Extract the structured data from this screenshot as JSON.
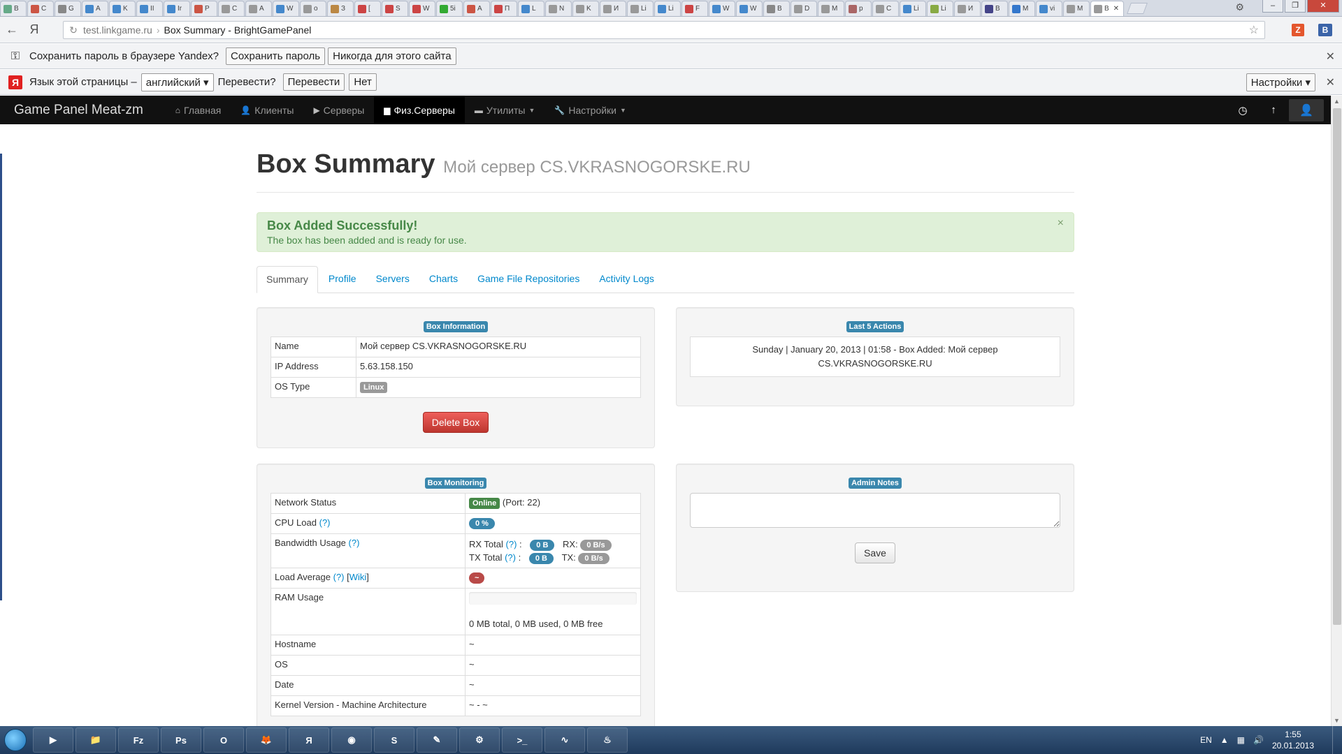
{
  "browser": {
    "tabs": [
      {
        "label": "В"
      },
      {
        "label": "С"
      },
      {
        "label": "G"
      },
      {
        "label": "A"
      },
      {
        "label": "K"
      },
      {
        "label": "II"
      },
      {
        "label": "Ir"
      },
      {
        "label": "P"
      },
      {
        "label": "C"
      },
      {
        "label": "A"
      },
      {
        "label": "W"
      },
      {
        "label": "o"
      },
      {
        "label": "З"
      },
      {
        "label": "["
      },
      {
        "label": "S"
      },
      {
        "label": "W"
      },
      {
        "label": "5i"
      },
      {
        "label": "A"
      },
      {
        "label": "П"
      },
      {
        "label": "L"
      },
      {
        "label": "N"
      },
      {
        "label": "K"
      },
      {
        "label": "И"
      },
      {
        "label": "Li"
      },
      {
        "label": "Li"
      },
      {
        "label": "F"
      },
      {
        "label": "W"
      },
      {
        "label": "W"
      },
      {
        "label": "B"
      },
      {
        "label": "D"
      },
      {
        "label": "M"
      },
      {
        "label": "p"
      },
      {
        "label": "C"
      },
      {
        "label": "Li"
      },
      {
        "label": "Li"
      },
      {
        "label": "И"
      },
      {
        "label": "B"
      },
      {
        "label": "M"
      },
      {
        "label": "vi"
      },
      {
        "label": "M"
      },
      {
        "label": "B"
      }
    ],
    "active_tab_close": "✕",
    "url_host": "test.linkgame.ru",
    "url_sep": "›",
    "page_title": "Box Summary - BrightGamePanel",
    "ext1": "Z",
    "ext2": "B"
  },
  "infobar_password": {
    "text": "Сохранить пароль в браузере Yandex?",
    "save_label": "Сохранить пароль",
    "never_label": "Никогда для этого сайта"
  },
  "infobar_translate": {
    "text": "Язык этой страницы –",
    "language": "английский",
    "question": "Перевести?",
    "translate_label": "Перевести",
    "no_label": "Нет",
    "settings_label": "Настройки"
  },
  "navbar": {
    "brand": "Game Panel Meat-zm",
    "items": [
      {
        "label": "Главная",
        "icon": "home-icon"
      },
      {
        "label": "Клиенты",
        "icon": "user-icon"
      },
      {
        "label": "Серверы",
        "icon": "play-icon"
      },
      {
        "label": "Физ.Серверы",
        "icon": "book-icon"
      },
      {
        "label": "Утилиты",
        "icon": "briefcase-icon"
      },
      {
        "label": "Настройки",
        "icon": "wrench-icon"
      }
    ]
  },
  "page": {
    "title": "Box Summary",
    "subtitle": "Мой сервер CS.VKRASNOGORSKE.RU"
  },
  "alert": {
    "heading": "Box Added Successfully!",
    "message": "The box has been added and is ready for use.",
    "close": "×"
  },
  "tabs": [
    "Summary",
    "Profile",
    "Servers",
    "Charts",
    "Game File Repositories",
    "Activity Logs"
  ],
  "box_info": {
    "heading": "Box Information",
    "name_label": "Name",
    "name_value": "Мой сервер CS.VKRASNOGORSKE.RU",
    "ip_label": "IP Address",
    "ip_value": "5.63.158.150",
    "os_label": "OS Type",
    "os_value": "Linux",
    "delete_label": "Delete Box"
  },
  "last_actions": {
    "heading": "Last 5 Actions",
    "line1": "Sunday | January 20, 2013 | 01:58 - Box Added: Мой сервер",
    "line2": "CS.VKRASNOGORSKE.RU"
  },
  "monitoring": {
    "heading": "Box Monitoring",
    "network_label": "Network Status",
    "network_status": "Online",
    "network_port": "(Port: 22)",
    "cpu_label": "CPU Load",
    "cpu_value": "0 %",
    "help": "(?)",
    "bandwidth_label": "Bandwidth Usage",
    "rx_total_label": "RX Total",
    "rx_total_value": "0 B",
    "rx_label": "RX:",
    "rx_value": "0 B/s",
    "tx_total_label": "TX Total",
    "tx_total_value": "0 B",
    "tx_label": "TX:",
    "tx_value": "0 B/s",
    "load_label": "Load Average",
    "wiki_label": "Wiki",
    "load_value": "~",
    "ram_label": "RAM Usage",
    "ram_text": "0 MB total, 0 MB used, 0 MB free",
    "hostname_label": "Hostname",
    "hostname_value": "~",
    "os_label": "OS",
    "os_value": "~",
    "date_label": "Date",
    "date_value": "~",
    "kernel_label": "Kernel Version - Machine Architecture",
    "kernel_value": "~ - ~"
  },
  "notes": {
    "heading": "Admin Notes",
    "save_label": "Save"
  },
  "taskbar": {
    "apps": [
      "▶",
      "📁",
      "Fz",
      "Ps",
      "O",
      "🦊",
      "Я",
      "◉",
      "S",
      "✎",
      "⚙",
      ">_",
      "∿",
      "♨"
    ],
    "lang": "EN",
    "time": "1:55",
    "date": "20.01.2013"
  }
}
